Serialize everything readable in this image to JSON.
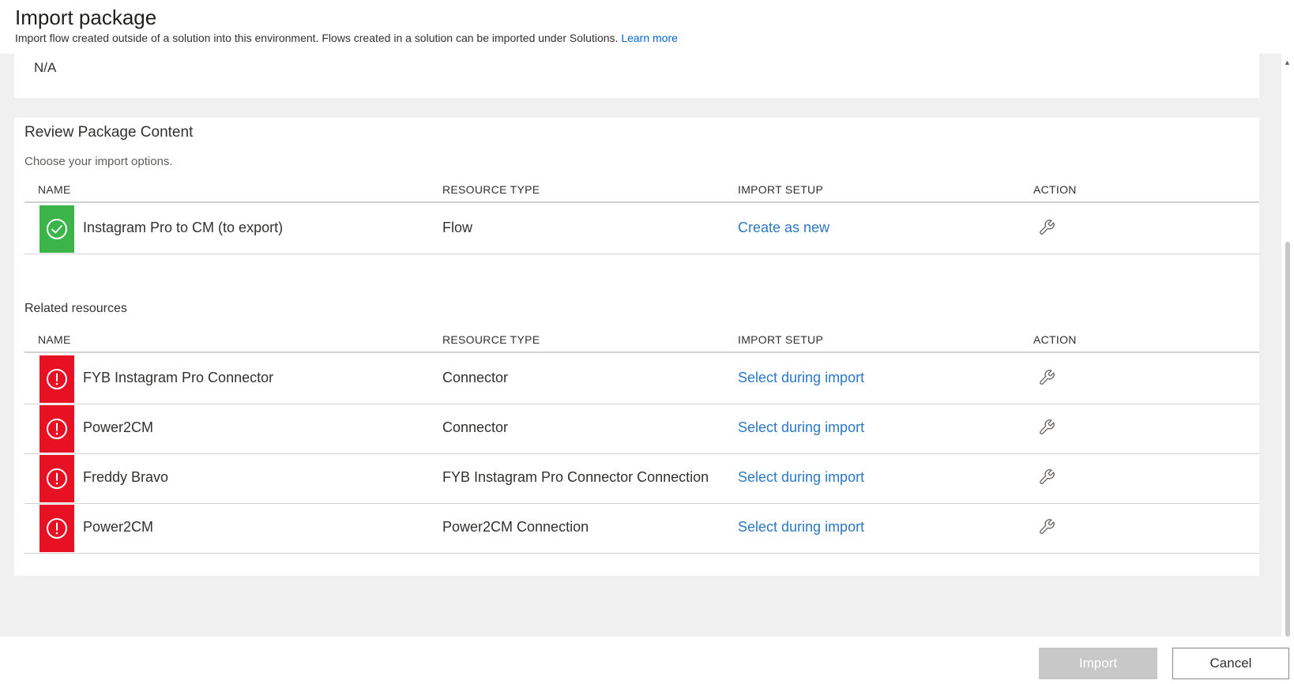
{
  "header": {
    "title": "Import package",
    "subtitle": "Import flow created outside of a solution into this environment. Flows created in a solution can be imported under Solutions.",
    "learn_more": "Learn more"
  },
  "top_card": {
    "value": "N/A"
  },
  "review": {
    "title": "Review Package Content",
    "description": "Choose your import options.",
    "columns": {
      "name": "NAME",
      "type": "RESOURCE TYPE",
      "setup": "IMPORT SETUP",
      "action": "ACTION"
    },
    "rows": [
      {
        "status": "success",
        "name": "Instagram Pro to CM (to export)",
        "type": "Flow",
        "setup": "Create as new",
        "action_icon": "wrench-icon"
      }
    ]
  },
  "related": {
    "title": "Related resources",
    "columns": {
      "name": "NAME",
      "type": "RESOURCE TYPE",
      "setup": "IMPORT SETUP",
      "action": "ACTION"
    },
    "rows": [
      {
        "status": "error",
        "name": "FYB Instagram Pro Connector",
        "type": "Connector",
        "setup": "Select during import",
        "action_icon": "wrench-icon"
      },
      {
        "status": "error",
        "name": "Power2CM",
        "type": "Connector",
        "setup": "Select during import",
        "action_icon": "wrench-icon"
      },
      {
        "status": "error",
        "name": "Freddy Bravo",
        "type": "FYB Instagram Pro Connector Connection",
        "setup": "Select during import",
        "action_icon": "wrench-icon"
      },
      {
        "status": "error",
        "name": "Power2CM",
        "type": "Power2CM Connection",
        "setup": "Select during import",
        "action_icon": "wrench-icon"
      }
    ]
  },
  "footer": {
    "import_label": "Import",
    "cancel_label": "Cancel"
  },
  "colors": {
    "success": "#3bb44a",
    "error": "#e81123",
    "link": "#2b78c5",
    "panel_bg": "#f0f0f0",
    "disabled_button": "#c8c8c8"
  }
}
